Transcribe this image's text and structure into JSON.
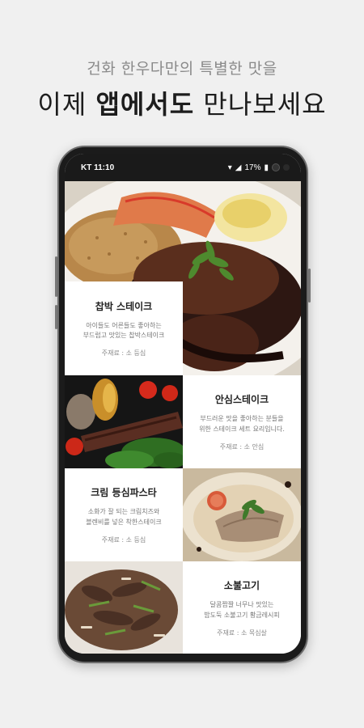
{
  "promo": {
    "subtitle": "건화 한우다만의 특별한 맛을",
    "headline_prefix": "이제 ",
    "headline_bold": "앱에서도",
    "headline_suffix": " 만나보세요"
  },
  "status_bar": {
    "carrier_time": "KT 11:10",
    "battery": "17%"
  },
  "menu": [
    {
      "name": "찹박 스테이크",
      "description_line1": "아이들도 어른들도 좋아하는",
      "description_line2": "부드럽고 맛있는 찹박스테이크",
      "ingredient": "주재료 : 소 등심"
    },
    {
      "name": "안심스테이크",
      "description_line1": "부드러운 맛을 좋아하는 분들을",
      "description_line2": "위한 스테이크 세트 요리입니다.",
      "ingredient": "주재료 : 소 안심"
    },
    {
      "name": "크림 등심파스타",
      "description_line1": "소화가 잘 되는 크림치즈와",
      "description_line2": "블렌비를 넣은 착한스테이크",
      "ingredient": "주재료 : 소 등심"
    },
    {
      "name": "소불고기",
      "description_line1": "달콤짭짤 너무나 맛있는",
      "description_line2": "밥도둑 소불고기 황금레시피",
      "ingredient": "주재료 : 소 목심살"
    }
  ]
}
